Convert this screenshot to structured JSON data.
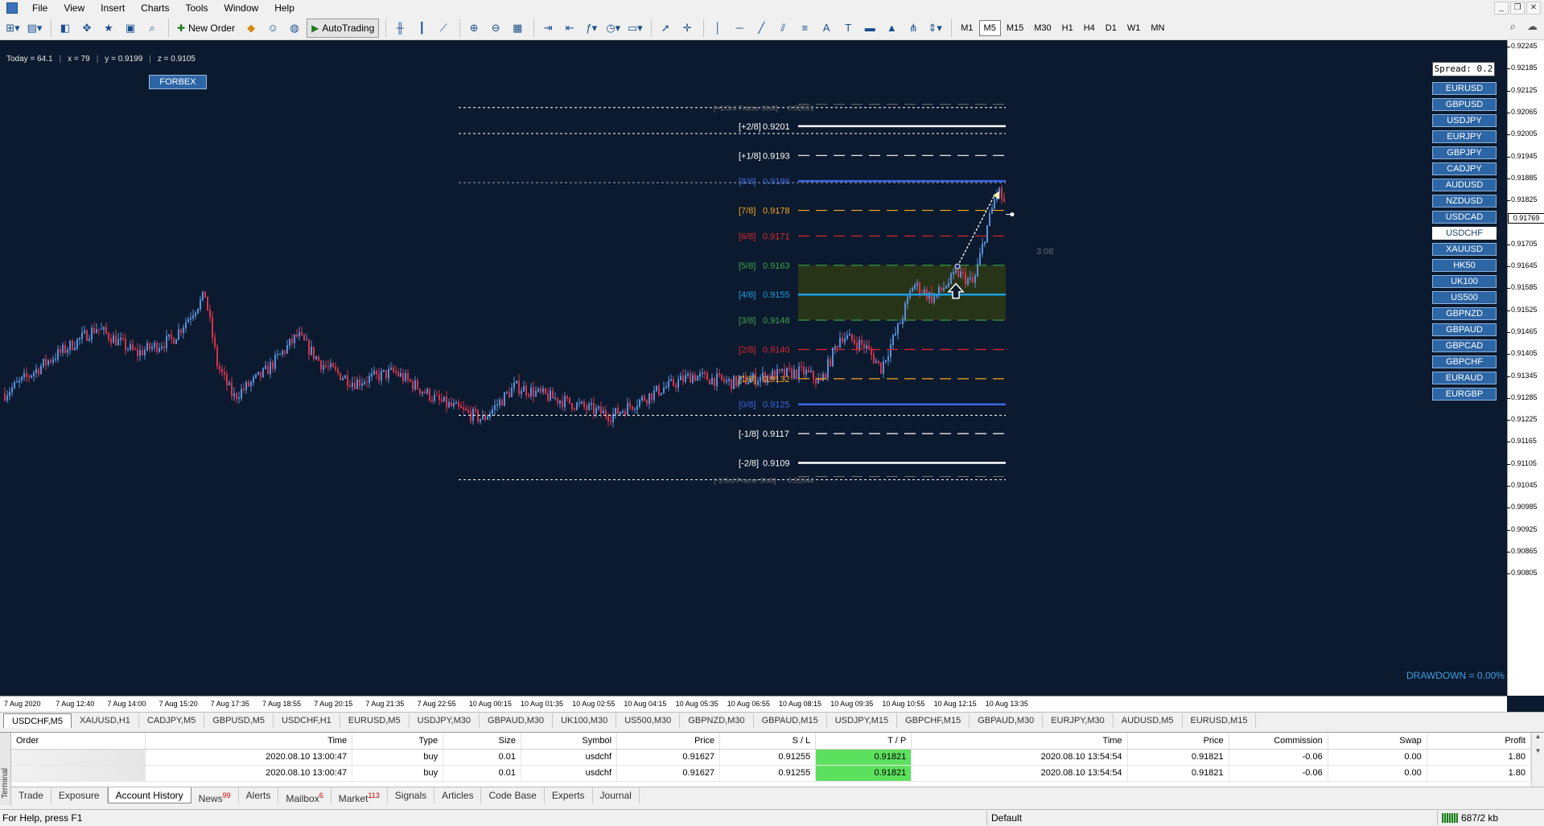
{
  "menu": {
    "items": [
      "File",
      "View",
      "Insert",
      "Charts",
      "Tools",
      "Window",
      "Help"
    ]
  },
  "toolbar": {
    "new_order": "New Order",
    "autotrading": "AutoTrading",
    "timeframes": [
      "M1",
      "M5",
      "M15",
      "M30",
      "H1",
      "H4",
      "D1",
      "W1",
      "MN"
    ],
    "active_timeframe": "M5"
  },
  "chart": {
    "info": {
      "today": "Today = 64.1",
      "x": "x = 79",
      "y": "y = 0.9199",
      "z": "z = 0.9105"
    },
    "forbex": "FORBEX",
    "spread": "Spread: 0.2",
    "symbols": [
      "EURUSD",
      "GBPUSD",
      "USDJPY",
      "EURJPY",
      "GBPJPY",
      "CADJPY",
      "AUDUSD",
      "NZDUSD",
      "USDCAD",
      "USDCHF",
      "XAUUSD",
      "HK50",
      "UK100",
      "US500",
      "GBPNZD",
      "GBPAUD",
      "GBPCAD",
      "GBPCHF",
      "EURAUD",
      "EURGBP"
    ],
    "active_symbol": "USDCHF",
    "drawdown": "DRAWDOWN = 0.00%",
    "timer": "3:08",
    "current_price": "0.91769",
    "murrey_levels": [
      {
        "label": "[+1/3rd Frame Shift]",
        "value": "0.92061",
        "price": 0.92061,
        "color": "#6e6e6e",
        "style": "shift"
      },
      {
        "label": "[+2/8]",
        "value": "0.9201",
        "price": 0.9201,
        "color": "#ffffff",
        "style": "solid"
      },
      {
        "label": "[+1/8]",
        "value": "0.9193",
        "price": 0.9193,
        "color": "#ffffff",
        "style": "dashed"
      },
      {
        "label": "[8/8]",
        "value": "0.9186",
        "price": 0.9186,
        "color": "#3a66e0",
        "style": "solid"
      },
      {
        "label": "[7/8]",
        "value": "0.9178",
        "price": 0.9178,
        "color": "#f5a623",
        "style": "dashed"
      },
      {
        "label": "[6/8]",
        "value": "0.9171",
        "price": 0.9171,
        "color": "#e0252e",
        "style": "dashed"
      },
      {
        "label": "[5/8]",
        "value": "0.9163",
        "price": 0.9163,
        "color": "#3ca54a",
        "style": "dashed"
      },
      {
        "label": "[4/8]",
        "value": "0.9155",
        "price": 0.9155,
        "color": "#1aa0e6",
        "style": "solid"
      },
      {
        "label": "[3/8]",
        "value": "0.9148",
        "price": 0.9148,
        "color": "#3ca54a",
        "style": "dashed"
      },
      {
        "label": "[2/8]",
        "value": "0.9140",
        "price": 0.914,
        "color": "#e0252e",
        "style": "dashed"
      },
      {
        "label": "[1/8]",
        "value": "0.9132",
        "price": 0.9132,
        "color": "#f5a623",
        "style": "dashed"
      },
      {
        "label": "[0/8]",
        "value": "0.9125",
        "price": 0.9125,
        "color": "#3a66e0",
        "style": "solid"
      },
      {
        "label": "[-1/8]",
        "value": "0.9117",
        "price": 0.9117,
        "color": "#ffffff",
        "style": "dashed"
      },
      {
        "label": "[-2/8]",
        "value": "0.9109",
        "price": 0.9109,
        "color": "#ffffff",
        "style": "solid"
      },
      {
        "label": "[-1/3rd Frame Shift]",
        "value": "0.91044",
        "price": 0.91044,
        "color": "#6e6e6e",
        "style": "shift"
      }
    ],
    "price_ticks": [
      "0.92245",
      "0.92185",
      "0.92125",
      "0.92065",
      "0.92005",
      "0.91945",
      "0.91885",
      "0.91825",
      "0.91769",
      "0.91705",
      "0.91645",
      "0.91585",
      "0.91525",
      "0.91465",
      "0.91405",
      "0.91345",
      "0.91285",
      "0.91225",
      "0.91165",
      "0.91105",
      "0.91045",
      "0.90985",
      "0.90925",
      "0.90865",
      "0.90805"
    ],
    "time_ticks": [
      "7 Aug 2020",
      "7 Aug 12:40",
      "7 Aug 14:00",
      "7 Aug 15:20",
      "7 Aug 17:35",
      "7 Aug 18:55",
      "7 Aug 20:15",
      "7 Aug 21:35",
      "7 Aug 22:55",
      "10 Aug 00:15",
      "10 Aug 01:35",
      "10 Aug 02:55",
      "10 Aug 04:15",
      "10 Aug 05:35",
      "10 Aug 06:55",
      "10 Aug 08:15",
      "10 Aug 09:35",
      "10 Aug 10:55",
      "10 Aug 12:15",
      "10 Aug 13:35"
    ]
  },
  "chart_tabs": [
    "USDCHF,M5",
    "XAUUSD,H1",
    "CADJPY,M5",
    "GBPUSD,M5",
    "USDCHF,H1",
    "EURUSD,M5",
    "USDJPY,M30",
    "GBPAUD,M30",
    "UK100,M30",
    "US500,M30",
    "GBPNZD,M30",
    "GBPAUD,M15",
    "USDJPY,M15",
    "GBPCHF,M15",
    "GBPAUD,M30",
    "EURJPY,M30",
    "AUDUSD,M5",
    "EURUSD,M15"
  ],
  "terminal": {
    "side_label": "Terminal",
    "columns": [
      "Order",
      "Time",
      "Type",
      "Size",
      "Symbol",
      "Price",
      "S / L",
      "T / P",
      "Time",
      "Price",
      "Commission",
      "Swap",
      "Profit"
    ],
    "rows": [
      [
        "",
        "2020.08.10 13:00:47",
        "buy",
        "0.01",
        "usdchf",
        "0.91627",
        "0.91255",
        "0.91821",
        "2020.08.10 13:54:54",
        "0.91821",
        "-0.06",
        "0.00",
        "1.80"
      ],
      [
        "",
        "2020.08.10 13:00:47",
        "buy",
        "0.01",
        "usdchf",
        "0.91627",
        "0.91255",
        "0.91821",
        "2020.08.10 13:54:54",
        "0.91821",
        "-0.06",
        "0.00",
        "1.80"
      ]
    ],
    "tabs": [
      {
        "label": "Trade",
        "badge": ""
      },
      {
        "label": "Exposure",
        "badge": ""
      },
      {
        "label": "Account History",
        "badge": ""
      },
      {
        "label": "News",
        "badge": "99"
      },
      {
        "label": "Alerts",
        "badge": ""
      },
      {
        "label": "Mailbox",
        "badge": "6"
      },
      {
        "label": "Market",
        "badge": "113"
      },
      {
        "label": "Signals",
        "badge": ""
      },
      {
        "label": "Articles",
        "badge": ""
      },
      {
        "label": "Code Base",
        "badge": ""
      },
      {
        "label": "Experts",
        "badge": ""
      },
      {
        "label": "Journal",
        "badge": ""
      }
    ],
    "active_tab": "Account History"
  },
  "status": {
    "help": "For Help, press F1",
    "profile": "Default",
    "traffic": "687/2 kb"
  }
}
